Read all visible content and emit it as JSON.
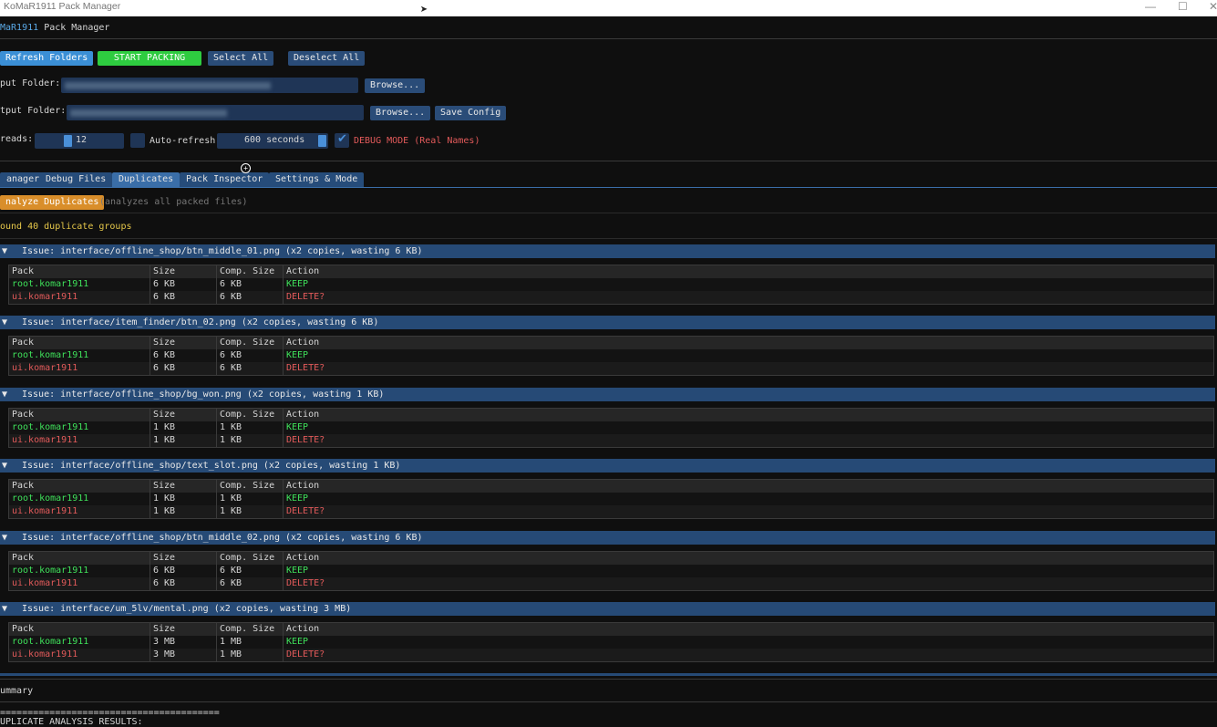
{
  "window": {
    "title": "KoMaR1911 Pack Manager",
    "minimize": "—",
    "maximize": "☐",
    "close": "✕"
  },
  "app": {
    "brand": "MaR1911",
    "name": "Pack Manager"
  },
  "toolbar": {
    "refresh": "Refresh Folders",
    "start": "START PACKING",
    "select_all": "Select All",
    "deselect_all": "Deselect All"
  },
  "input_folder": {
    "label": "put Folder:",
    "browse": "Browse..."
  },
  "output_folder": {
    "label": "tput Folder:",
    "browse": "Browse...",
    "save": "Save Config"
  },
  "threads": {
    "label": "reads:",
    "value": "12",
    "auto_refresh_label": "Auto-refresh",
    "auto_refresh_checked": false,
    "interval": "600 seconds",
    "debug_label": "DEBUG MODE (Real Names)",
    "debug_checked": true
  },
  "tabs": [
    "anager",
    "Debug Files",
    "Duplicates",
    "Pack Inspector",
    "Settings & Mode"
  ],
  "active_tab": 2,
  "analyze": {
    "button": "nalyze Duplicates",
    "hint": "(analyzes all packed files)"
  },
  "found": "ound 40 duplicate groups",
  "columns": [
    "Pack",
    "Size",
    "Comp. Size",
    "Action"
  ],
  "groups": [
    {
      "header": "Issue: interface/offline_shop/btn_middle_01.png (x2 copies, wasting 6 KB)",
      "rows": [
        [
          "root.komar1911",
          "6 KB",
          "6 KB",
          "KEEP"
        ],
        [
          "ui.komar1911",
          "6 KB",
          "6 KB",
          "DELETE?"
        ]
      ]
    },
    {
      "header": "Issue: interface/item_finder/btn_02.png (x2 copies, wasting 6 KB)",
      "rows": [
        [
          "root.komar1911",
          "6 KB",
          "6 KB",
          "KEEP"
        ],
        [
          "ui.komar1911",
          "6 KB",
          "6 KB",
          "DELETE?"
        ]
      ]
    },
    {
      "header": "Issue: interface/offline_shop/bg_won.png (x2 copies, wasting 1 KB)",
      "rows": [
        [
          "root.komar1911",
          "1 KB",
          "1 KB",
          "KEEP"
        ],
        [
          "ui.komar1911",
          "1 KB",
          "1 KB",
          "DELETE?"
        ]
      ]
    },
    {
      "header": "Issue: interface/offline_shop/text_slot.png (x2 copies, wasting 1 KB)",
      "rows": [
        [
          "root.komar1911",
          "1 KB",
          "1 KB",
          "KEEP"
        ],
        [
          "ui.komar1911",
          "1 KB",
          "1 KB",
          "DELETE?"
        ]
      ]
    },
    {
      "header": "Issue: interface/offline_shop/btn_middle_02.png (x2 copies, wasting 6 KB)",
      "rows": [
        [
          "root.komar1911",
          "6 KB",
          "6 KB",
          "KEEP"
        ],
        [
          "ui.komar1911",
          "6 KB",
          "6 KB",
          "DELETE?"
        ]
      ]
    },
    {
      "header": "Issue: interface/um_5lv/mental.png (x2 copies, wasting 3 MB)",
      "rows": [
        [
          "root.komar1911",
          "3 MB",
          "1 MB",
          "KEEP"
        ],
        [
          "ui.komar1911",
          "3 MB",
          "1 MB",
          "DELETE?"
        ]
      ]
    }
  ],
  "summary": {
    "title": "ummary",
    "rule": "========================================",
    "results_label": "UPLICATE ANALYSIS RESULTS:"
  }
}
